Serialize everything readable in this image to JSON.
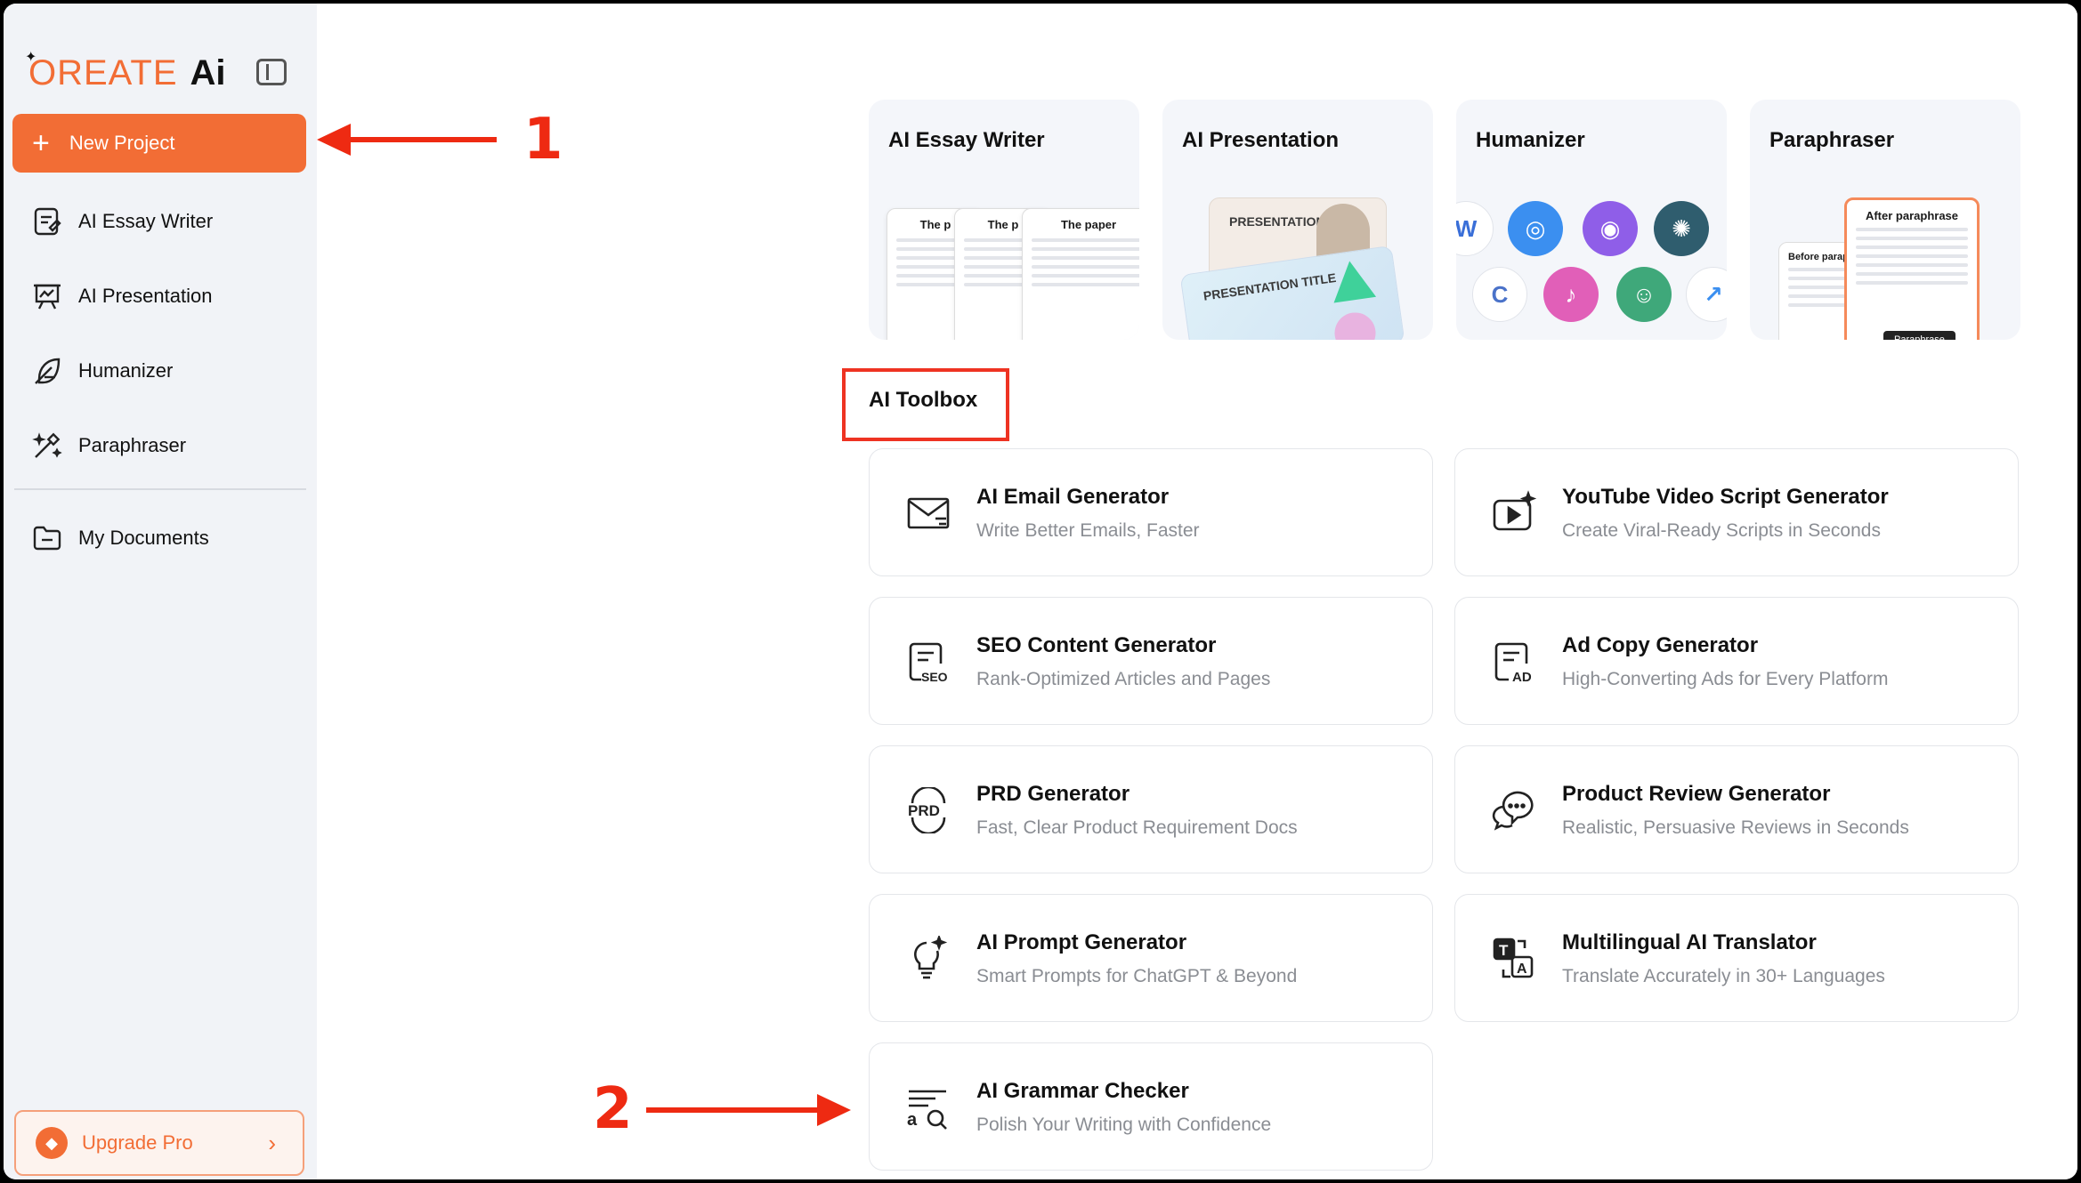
{
  "brand": {
    "logo_text": "OREATE",
    "logo_ai": "Ai"
  },
  "sidebar": {
    "new_project_label": "New Project",
    "items": [
      {
        "label": "AI Essay Writer",
        "icon": "essay-icon"
      },
      {
        "label": "AI Presentation",
        "icon": "presentation-icon"
      },
      {
        "label": "Humanizer",
        "icon": "feather-icon"
      },
      {
        "label": "Paraphraser",
        "icon": "magic-wand-icon"
      },
      {
        "label": "My Documents",
        "icon": "folder-icon"
      }
    ],
    "upgrade_label": "Upgrade Pro"
  },
  "features": [
    {
      "title": "AI Essay Writer",
      "paper_title": "The paper",
      "paper_title_short": "The p"
    },
    {
      "title": "AI Presentation",
      "slide_text": "PRESENTATION TITLE"
    },
    {
      "title": "Humanizer"
    },
    {
      "title": "Paraphraser",
      "after_label": "After paraphrase",
      "before_label": "Before paraphrase",
      "button_label": "Paraphrase"
    }
  ],
  "toolbox": {
    "title": "AI Toolbox",
    "tools": [
      {
        "title": "AI Email Generator",
        "subtitle": "Write Better Emails, Faster",
        "icon": "email-icon"
      },
      {
        "title": "YouTube Video Script Generator",
        "subtitle": "Create Viral-Ready Scripts in Seconds",
        "icon": "video-script-icon"
      },
      {
        "title": "SEO Content Generator",
        "subtitle": "Rank-Optimized Articles and Pages",
        "icon": "seo-icon"
      },
      {
        "title": "Ad Copy Generator",
        "subtitle": "High-Converting Ads for Every Platform",
        "icon": "ad-icon"
      },
      {
        "title": "PRD Generator",
        "subtitle": "Fast, Clear Product Requirement Docs",
        "icon": "prd-icon"
      },
      {
        "title": "Product Review Generator",
        "subtitle": "Realistic, Persuasive Reviews in Seconds",
        "icon": "review-chat-icon"
      },
      {
        "title": "AI Prompt Generator",
        "subtitle": "Smart Prompts for ChatGPT & Beyond",
        "icon": "lightbulb-icon"
      },
      {
        "title": "Multilingual AI Translator",
        "subtitle": "Translate Accurately in 30+ Languages",
        "icon": "translate-icon"
      },
      {
        "title": "AI Grammar Checker",
        "subtitle": "Polish Your Writing with Confidence",
        "icon": "grammar-check-icon"
      }
    ]
  },
  "annotations": {
    "one": "1",
    "two": "2"
  },
  "colors": {
    "accent": "#f26d35",
    "annotation": "#ee2a12",
    "sidebar_bg": "#f1f3f7"
  }
}
